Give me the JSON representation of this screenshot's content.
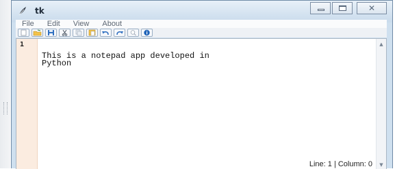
{
  "window": {
    "title": "tk",
    "controls": {
      "minimize": "minimize",
      "maximize": "maximize",
      "close_glyph": "✕"
    }
  },
  "menubar": {
    "items": [
      {
        "label": "File"
      },
      {
        "label": "Edit"
      },
      {
        "label": "View"
      },
      {
        "label": "About"
      }
    ]
  },
  "toolbar": {
    "buttons": [
      {
        "icon": "new-file-icon"
      },
      {
        "icon": "open-folder-icon"
      },
      {
        "icon": "save-icon"
      },
      {
        "icon": "cut-icon"
      },
      {
        "icon": "copy-icon"
      },
      {
        "icon": "paste-icon"
      },
      {
        "icon": "undo-icon"
      },
      {
        "icon": "redo-icon"
      },
      {
        "icon": "find-icon"
      },
      {
        "icon": "info-icon"
      }
    ]
  },
  "editor": {
    "line_numbers": [
      "1"
    ],
    "lines": [
      "This is a notepad app developed in",
      "Python"
    ]
  },
  "status": {
    "text": "Line: 1 | Column: 0"
  },
  "colors": {
    "accent_blue": "#2f6fc0",
    "gutter": "#fbece0",
    "titlebar": "#d6e4f1"
  }
}
